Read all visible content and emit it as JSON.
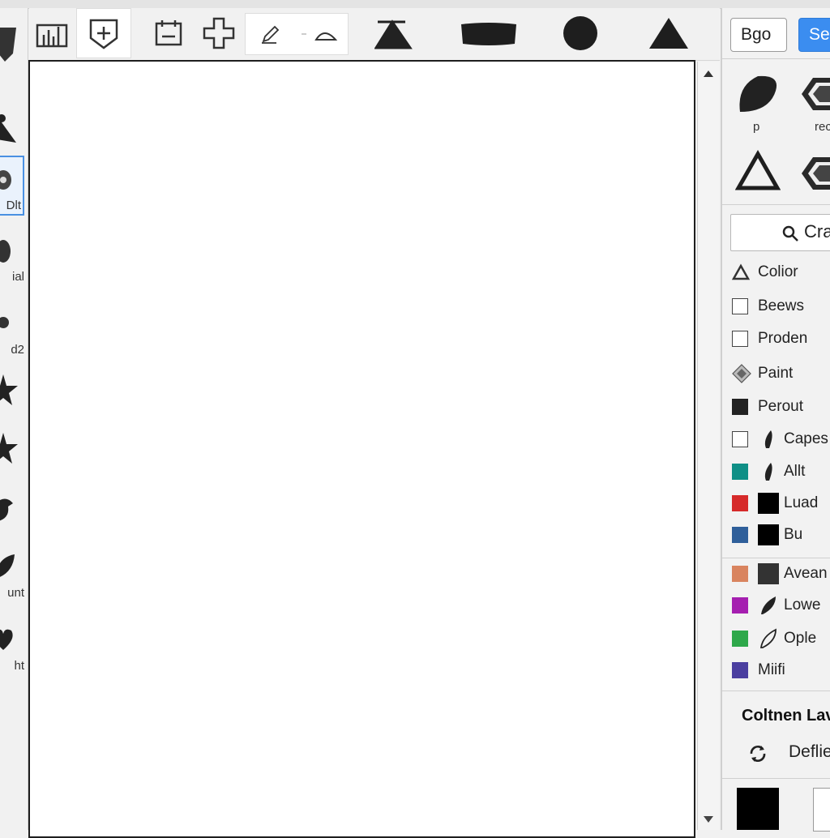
{
  "left_tools": [
    {
      "icon": "shield-icon",
      "label": ""
    },
    {
      "icon": "pen-icon",
      "label": ""
    },
    {
      "icon": "blob-icon",
      "label": "Dlt"
    },
    {
      "icon": "drop-icon",
      "label": "ial"
    },
    {
      "icon": "dot-icon",
      "label": "d2"
    },
    {
      "icon": "star-icon",
      "label": ""
    },
    {
      "icon": "star-icon",
      "label": ""
    },
    {
      "icon": "bird-icon",
      "label": ""
    },
    {
      "icon": "leaf-icon",
      "label": "unt"
    },
    {
      "icon": "heart-icon",
      "label": "ht"
    }
  ],
  "toolbar": {
    "icons": [
      "chart-icon",
      "shield-plus-icon",
      "calendar-icon",
      "plus-icon",
      "pencil-icon",
      "arc-icon",
      "fill-icon",
      "brush-icon",
      "circle-icon",
      "triangle-icon"
    ]
  },
  "right_panel": {
    "btn_bg": "Bgo",
    "btn_primary": "Se",
    "shapes": [
      {
        "icon": "leaf-shape-icon",
        "label": "p"
      },
      {
        "icon": "hexagon-icon",
        "label": "rec"
      },
      {
        "icon": "triangle-outline-icon",
        "label": ""
      },
      {
        "icon": "hexagon-icon",
        "label": ""
      }
    ],
    "search_text": "Cra",
    "items": [
      {
        "swatch": "triangle",
        "color": "",
        "label": "Colior",
        "icon2": ""
      },
      {
        "swatch": "outline",
        "color": "",
        "label": "Beews",
        "icon2": ""
      },
      {
        "swatch": "outline",
        "color": "",
        "label": "Proden",
        "icon2": ""
      },
      {
        "swatch": "diamond",
        "color": "",
        "label": "Paint",
        "icon2": ""
      },
      {
        "swatch": "fill",
        "color": "#222222",
        "label": "Perout",
        "icon2": ""
      },
      {
        "swatch": "outline",
        "color": "",
        "label": "Capes",
        "icon2": "brush"
      },
      {
        "swatch": "fill",
        "color": "#0f8f86",
        "label": "Allt",
        "icon2": "brush"
      },
      {
        "swatch": "fill",
        "color": "#d62a2a",
        "label": "Luad",
        "icon2": "square-black"
      },
      {
        "swatch": "fill",
        "color": "#2f5f9a",
        "label": "Bu",
        "icon2": "square-black"
      },
      {
        "swatch": "fill",
        "color": "#d9845f",
        "label": "Avean",
        "icon2": "square-dark"
      },
      {
        "swatch": "fill",
        "color": "#a51fb0",
        "label": "Lowe",
        "icon2": "brush"
      },
      {
        "swatch": "fill",
        "color": "#2ea84a",
        "label": "Ople",
        "icon2": "brush-outline"
      },
      {
        "swatch": "fill",
        "color": "#4b3fa0",
        "label": "Miifi",
        "icon2": ""
      }
    ],
    "section_title": "Coltnen Lav",
    "deflect_label": "Deflie"
  },
  "colors": {
    "accent": "#3b8df0",
    "active_border": "#4a90e2"
  }
}
